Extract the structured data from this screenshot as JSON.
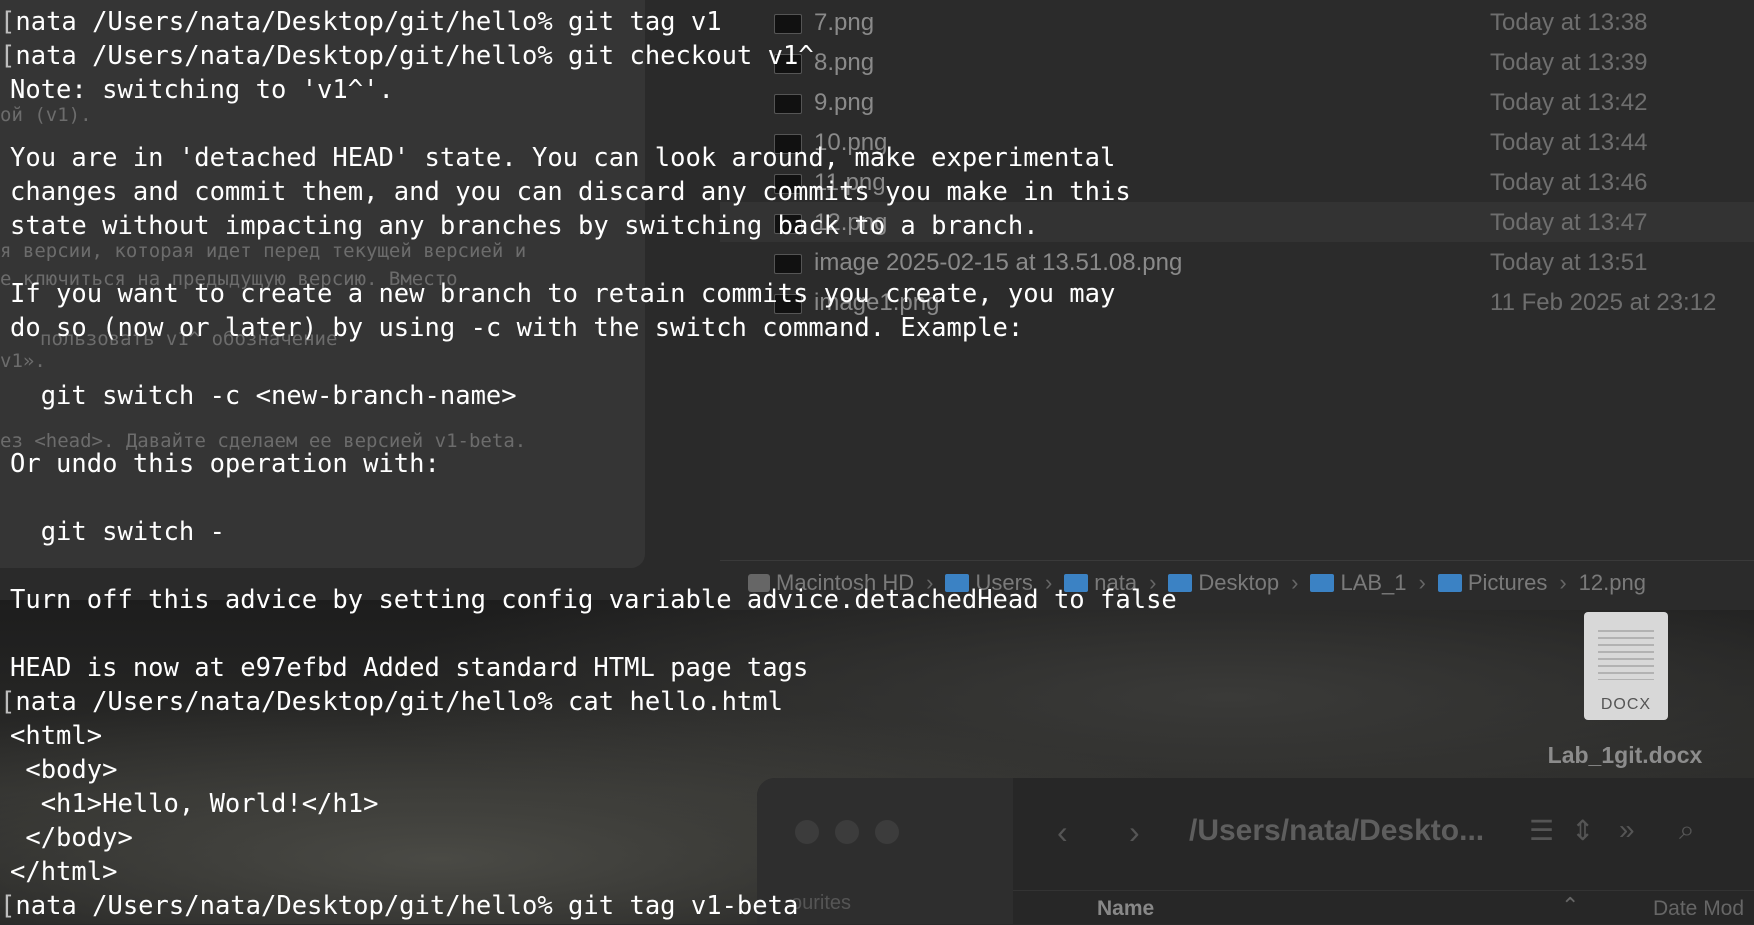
{
  "finder": {
    "rows": [
      {
        "name": "7.png",
        "date": "Today at 13:38"
      },
      {
        "name": "8.png",
        "date": "Today at 13:39"
      },
      {
        "name": "9.png",
        "date": "Today at 13:42"
      },
      {
        "name": "10.png",
        "date": "Today at 13:44"
      },
      {
        "name": "11.png",
        "date": "Today at 13:46"
      },
      {
        "name": "12.png",
        "date": "Today at 13:47"
      },
      {
        "name": "image 2025-02-15 at 13.51.08.png",
        "date": "Today at 13:51"
      },
      {
        "name": "image1.png",
        "date": "11 Feb 2025 at 23:12"
      }
    ],
    "path": [
      "Macintosh HD",
      "Users",
      "nata",
      "Desktop",
      "LAB_1",
      "Pictures",
      "12.png"
    ]
  },
  "desktop": {
    "docx_tag": "DOCX",
    "docx_name": "Lab_1git.docx"
  },
  "finder2": {
    "title": "/Users/nata/Deskto...",
    "sidebar_label": "ourites",
    "col_name": "Name",
    "col_date": "Date Mod"
  },
  "ghost_doc": {
    "lines": [
      "ой (v1).",
      "я версии, которая идет перед текущей версией и",
      "е ключиться на предыдущую версию. Вместо",
      "пользовать v1^ обозначение",
      "v1».",
      "ез <head>. Давайте сделаем ее версией v1-beta."
    ]
  },
  "terminal": {
    "lines": [
      {
        "prompt": "nata /Users/nata/Desktop/git/hello%",
        "text": " git tag v1"
      },
      {
        "prompt": "nata /Users/nata/Desktop/git/hello%",
        "text": " git checkout v1^"
      },
      {
        "prompt": "",
        "text": "Note: switching to 'v1^'."
      },
      {
        "prompt": "",
        "text": ""
      },
      {
        "prompt": "",
        "text": "You are in 'detached HEAD' state. You can look around, make experimental"
      },
      {
        "prompt": "",
        "text": "changes and commit them, and you can discard any commits you make in this"
      },
      {
        "prompt": "",
        "text": "state without impacting any branches by switching back to a branch."
      },
      {
        "prompt": "",
        "text": ""
      },
      {
        "prompt": "",
        "text": "If you want to create a new branch to retain commits you create, you may"
      },
      {
        "prompt": "",
        "text": "do so (now or later) by using -c with the switch command. Example:"
      },
      {
        "prompt": "",
        "text": ""
      },
      {
        "prompt": "",
        "text": "  git switch -c <new-branch-name>"
      },
      {
        "prompt": "",
        "text": ""
      },
      {
        "prompt": "",
        "text": "Or undo this operation with:"
      },
      {
        "prompt": "",
        "text": ""
      },
      {
        "prompt": "",
        "text": "  git switch -"
      },
      {
        "prompt": "",
        "text": ""
      },
      {
        "prompt": "",
        "text": "Turn off this advice by setting config variable advice.detachedHead to false"
      },
      {
        "prompt": "",
        "text": ""
      },
      {
        "prompt": "",
        "text": "HEAD is now at e97efbd Added standard HTML page tags"
      },
      {
        "prompt": "nata /Users/nata/Desktop/git/hello%",
        "text": " cat hello.html"
      },
      {
        "prompt": "",
        "text": "<html>"
      },
      {
        "prompt": "",
        "text": " <body>"
      },
      {
        "prompt": "",
        "text": "  <h1>Hello, World!</h1>"
      },
      {
        "prompt": "",
        "text": " </body>"
      },
      {
        "prompt": "",
        "text": "</html>"
      },
      {
        "prompt": "nata /Users/nata/Desktop/git/hello%",
        "text": " git tag v1-beta"
      }
    ]
  }
}
